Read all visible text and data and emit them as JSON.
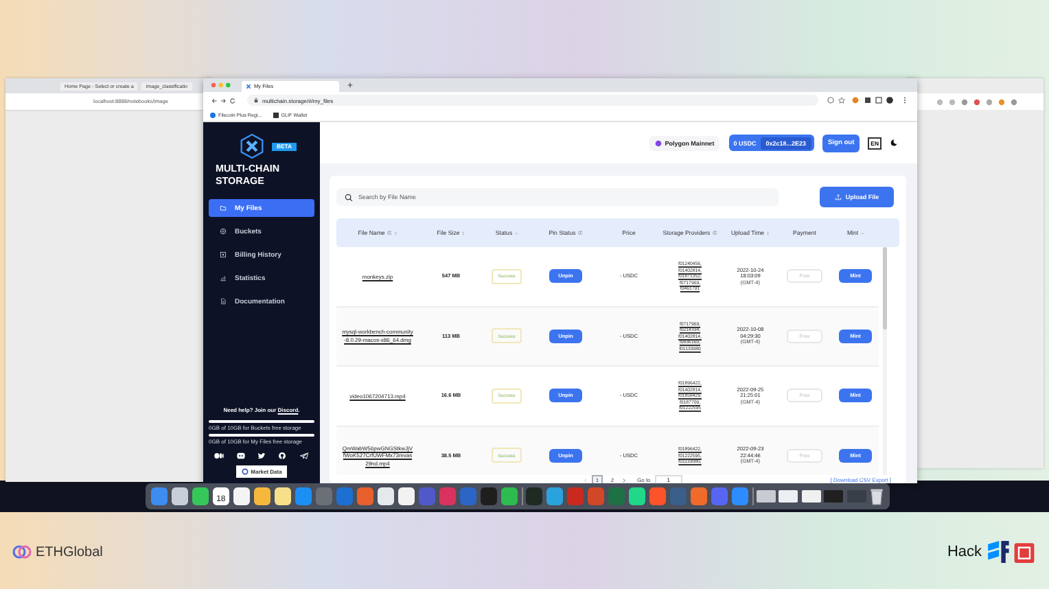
{
  "back_window_left": {
    "tabs": [
      {
        "title": "Home Page - Select or create a"
      },
      {
        "title": "image_classificatio"
      }
    ],
    "url": "localhost:8888/notebooks/image"
  },
  "browser": {
    "tab": "My Files",
    "url": "multichain.storage/#/my_files",
    "bookmarks": [
      "Filecoin Plus Regi...",
      "GLIF Wallet"
    ]
  },
  "sidebar": {
    "badge": "BETA",
    "brand": "MULTI-CHAIN STORAGE",
    "items": [
      {
        "label": "My Files",
        "selected": true
      },
      {
        "label": "Buckets",
        "selected": false
      },
      {
        "label": "Billing History",
        "selected": false
      },
      {
        "label": "Statistics",
        "selected": false
      },
      {
        "label": "Documentation",
        "selected": false
      }
    ],
    "help": {
      "text": "Need help? Join our ",
      "link": "Discord",
      "end": "."
    },
    "quotas": [
      {
        "label": "0GB of 10GB for Buckets free storage"
      },
      {
        "label": "0GB of 10GB for My Files free storage"
      }
    ],
    "market_badge": "Market Data"
  },
  "header": {
    "network": "Polygon Mainnet",
    "balance": "0 USDC",
    "address": "0x2c18...2E23",
    "sign_out": "Sign out",
    "language": "EN"
  },
  "files": {
    "search_placeholder": "Search by File Name",
    "upload": "Upload File",
    "columns": [
      "File Name",
      "File Size",
      "Status",
      "Pin Status",
      "Price",
      "Storage Providers",
      "Upload Time",
      "Payment",
      "Mint"
    ],
    "rows": [
      {
        "name": "monkeys.zip",
        "size": "547 MB",
        "status": "Success",
        "pin": "Unpin",
        "price": "- USDC",
        "providers": [
          "f01240456,",
          "f01402814,",
          "f01871352,",
          "f0717969,",
          "f0461791"
        ],
        "time": "2022-10-24",
        "clock": "18:03:09",
        "zone": "(GMT-4)",
        "payment": "Free",
        "mint": "Mint"
      },
      {
        "name": "mysql-workbench-community-8.0.29-macos-x86_64.dmg",
        "size": "113 MB",
        "status": "Success",
        "pin": "Unpin",
        "price": "- USDC",
        "providers": [
          "f0717969,",
          "f0214334,",
          "f01402814,",
          "f0836160,",
          "f01133080"
        ],
        "time": "2022-10-08",
        "clock": "04:29:30",
        "zone": "(GMT-4)",
        "payment": "Free",
        "mint": "Mint"
      },
      {
        "name": "video1067204713.mp4",
        "size": "16.6 MB",
        "status": "Success",
        "pin": "Unpin",
        "price": "- USDC",
        "providers": [
          "f01896422,",
          "f01402814,",
          "f01858429,",
          "f0187709,",
          "f01222595"
        ],
        "time": "2022-09-25",
        "clock": "21:25:01",
        "zone": "(GMT-4)",
        "payment": "Free",
        "mint": "Mint"
      },
      {
        "name": "QmWabW56pwGNGStkwJjVfWoK527CrfUWFMx73mvas29nd.mp4",
        "size": "38.5 MB",
        "status": "Success",
        "pin": "Unpin",
        "price": "- USDC",
        "providers": [
          "f01896422,",
          "f01222595,",
          "f01133080,"
        ],
        "time": "2022-09-23",
        "clock": "22:44:46",
        "zone": "(GMT-4)",
        "payment": "Free",
        "mint": "Mint"
      }
    ],
    "pages": [
      {
        "label": "1",
        "selected": true
      },
      {
        "label": "2",
        "selected": false
      }
    ],
    "goto_label": "Go to",
    "goto_value": "1",
    "export": "[ Download CSV Export ]"
  },
  "dock": [
    {
      "color": "#3d8cf0"
    },
    {
      "color": "#c9cfd8"
    },
    {
      "color": "#35c759"
    },
    {
      "color": "#ffffff",
      "label": "18"
    },
    {
      "color": "#f4f4f4"
    },
    {
      "color": "#f5b83d"
    },
    {
      "color": "#f7e08a"
    },
    {
      "color": "#1c8ff5"
    },
    {
      "color": "#6b6f78"
    },
    {
      "color": "#1d6fd1"
    },
    {
      "color": "#e8602c"
    },
    {
      "color": "#e4e9ee"
    },
    {
      "color": "#f2f2f2"
    },
    {
      "color": "#5059c9"
    },
    {
      "color": "#d9325e"
    },
    {
      "color": "#2b65c6"
    },
    {
      "color": "#1e1e1e"
    },
    {
      "color": "#2dbb4f"
    },
    {
      "color": "#1e2a22"
    },
    {
      "color": "#2aa3dd"
    },
    {
      "color": "#c9291e"
    },
    {
      "color": "#d24726"
    },
    {
      "color": "#1e7145"
    },
    {
      "color": "#21d789"
    },
    {
      "color": "#fb542b"
    },
    {
      "color": "#3a5f8a"
    },
    {
      "color": "#f06b2b"
    },
    {
      "color": "#5865f2"
    },
    {
      "color": "#2d8cff"
    }
  ],
  "event": {
    "left": "ETHGlobal",
    "right": "Hack"
  }
}
